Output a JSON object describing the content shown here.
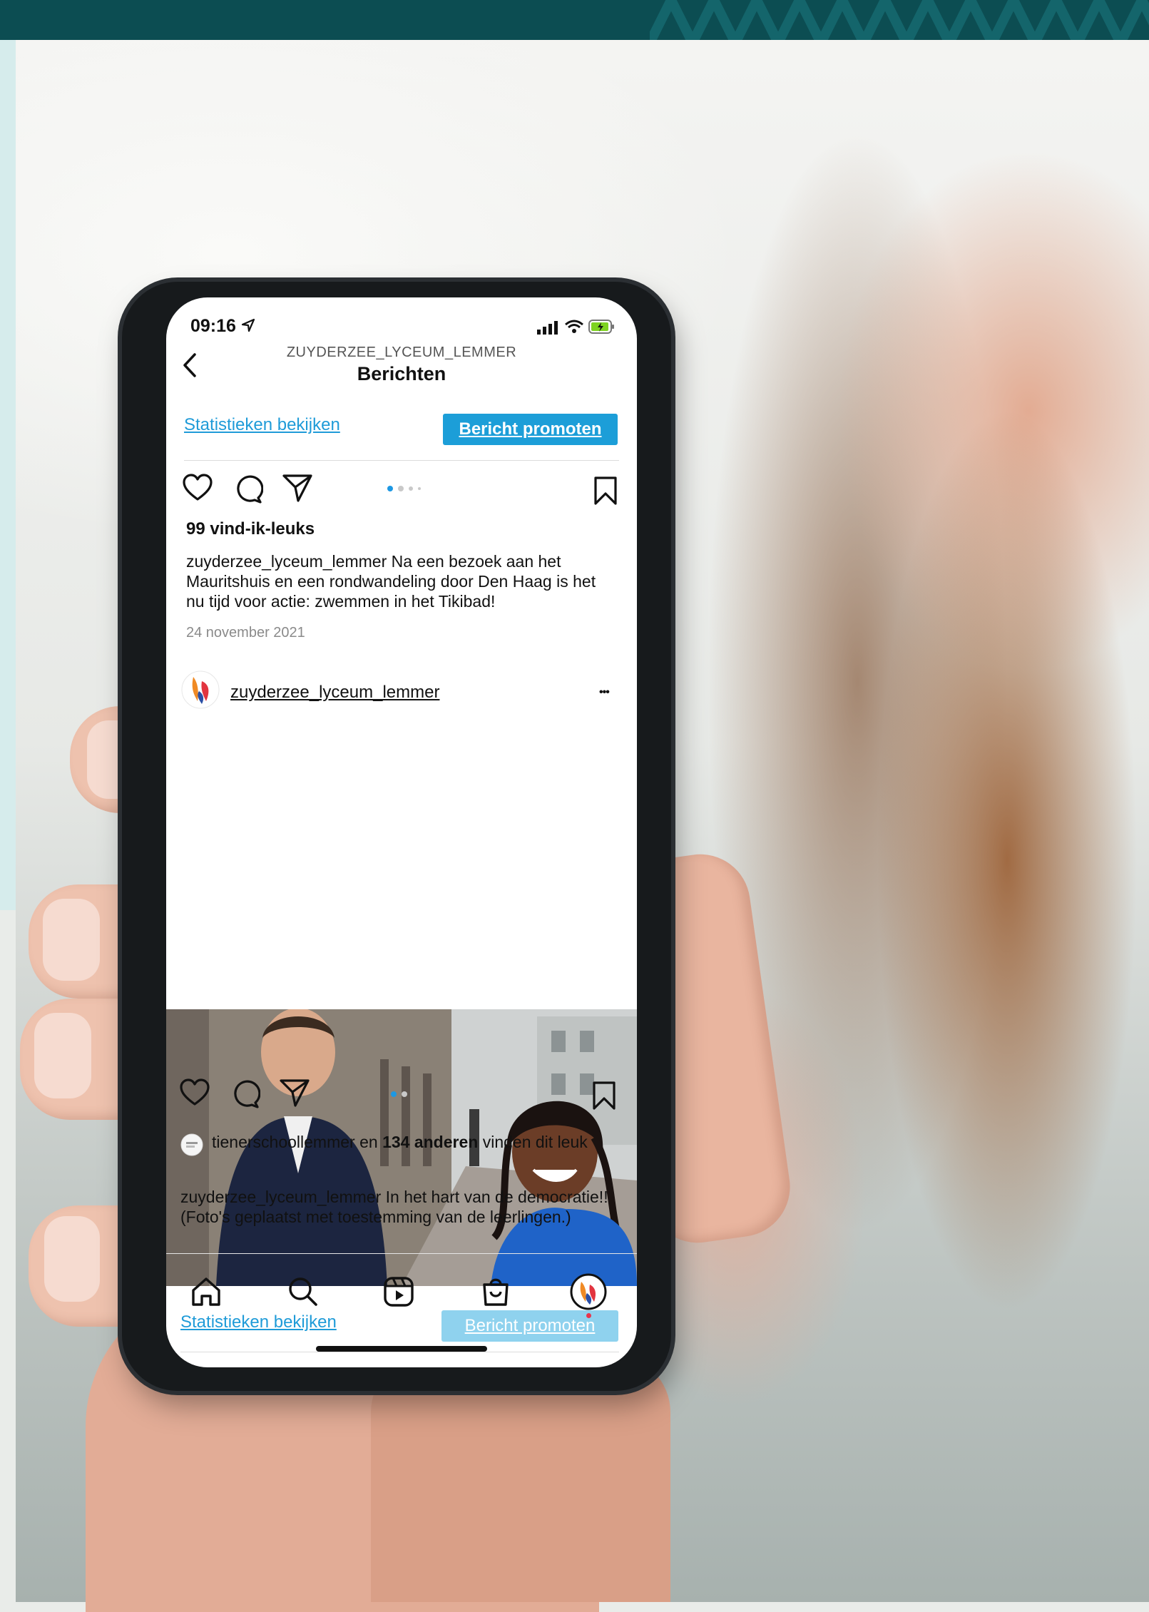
{
  "status_bar": {
    "time": "09:16"
  },
  "header": {
    "account": "ZUYDERZEE_LYCEUM_LEMMER",
    "title": "Berichten"
  },
  "post1": {
    "stats_label": "Statistieken bekijken",
    "promote_label": "Bericht promoten",
    "likes": "99 vind-ik-leuks",
    "caption_user": "zuyderzee_lyceum_lemmer",
    "caption_text": " Na een bezoek aan het Mauritshuis en een rondwandeling door Den Haag is het nu tijd voor actie: zwemmen in het Tikibad!",
    "date": "24 november 2021"
  },
  "post2": {
    "username": "zuyderzee_lyceum_lemmer",
    "more_label": "•••",
    "stats_label": "Statistieken bekijken",
    "promote_label": "Bericht promoten",
    "liked_by_user": "tienerschoollemmer",
    "liked_by_mid": " en ",
    "liked_by_count": "134 anderen",
    "liked_by_end": " vinden dit leuk",
    "caption_user": "zuyderzee_lyceum_lemmer",
    "caption_text": " In het hart van de democratie!! (Foto's geplaatst met toestemming van de leerlingen.)"
  },
  "colors": {
    "link_blue": "#1f9bd8",
    "promote_active": "#1c9ed8",
    "promote_disabled": "#8fd2ee",
    "top_band": "#0c4d52",
    "notification_dot": "#e8344c"
  },
  "icons": {
    "tab_bar": [
      "home-icon",
      "search-icon",
      "reels-icon",
      "shop-icon",
      "profile-avatar"
    ],
    "actions": [
      "heart-icon",
      "comment-icon",
      "share-icon",
      "bookmark-icon"
    ]
  }
}
